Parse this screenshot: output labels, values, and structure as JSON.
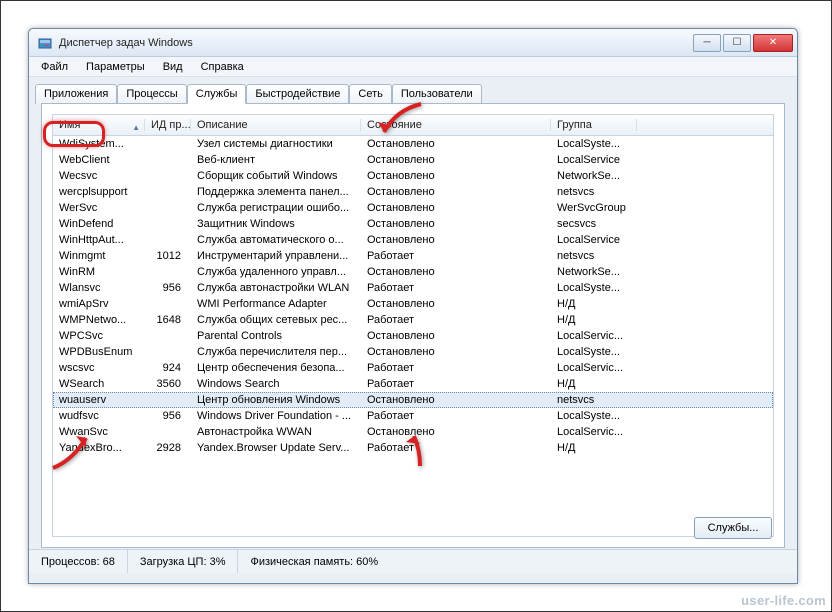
{
  "title": "Диспетчер задач Windows",
  "menu": [
    "Файл",
    "Параметры",
    "Вид",
    "Справка"
  ],
  "tabs": [
    "Приложения",
    "Процессы",
    "Службы",
    "Быстродействие",
    "Сеть",
    "Пользователи"
  ],
  "activeTab": 2,
  "columns": [
    "Имя",
    "ИД пр...",
    "Описание",
    "Состояние",
    "Группа"
  ],
  "servicesButton": "Службы...",
  "status": {
    "processes": "Процессов: 68",
    "cpu": "Загрузка ЦП: 3%",
    "memory": "Физическая память: 60%"
  },
  "watermark": "user-life.com",
  "services": [
    {
      "name": "WdiSystem...",
      "pid": "",
      "desc": "Узел системы диагностики",
      "state": "Остановлено",
      "group": "LocalSyste..."
    },
    {
      "name": "WebClient",
      "pid": "",
      "desc": "Веб-клиент",
      "state": "Остановлено",
      "group": "LocalService"
    },
    {
      "name": "Wecsvc",
      "pid": "",
      "desc": "Сборщик событий Windows",
      "state": "Остановлено",
      "group": "NetworkSe..."
    },
    {
      "name": "wercplsupport",
      "pid": "",
      "desc": "Поддержка элемента панел...",
      "state": "Остановлено",
      "group": "netsvcs"
    },
    {
      "name": "WerSvc",
      "pid": "",
      "desc": "Служба регистрации ошибо...",
      "state": "Остановлено",
      "group": "WerSvcGroup"
    },
    {
      "name": "WinDefend",
      "pid": "",
      "desc": "Защитник Windows",
      "state": "Остановлено",
      "group": "secsvcs"
    },
    {
      "name": "WinHttpAut...",
      "pid": "",
      "desc": "Служба автоматического о...",
      "state": "Остановлено",
      "group": "LocalService"
    },
    {
      "name": "Winmgmt",
      "pid": "1012",
      "desc": "Инструментарий управлени...",
      "state": "Работает",
      "group": "netsvcs"
    },
    {
      "name": "WinRM",
      "pid": "",
      "desc": "Служба удаленного управл...",
      "state": "Остановлено",
      "group": "NetworkSe..."
    },
    {
      "name": "Wlansvc",
      "pid": "956",
      "desc": "Служба автонастройки WLAN",
      "state": "Работает",
      "group": "LocalSyste..."
    },
    {
      "name": "wmiApSrv",
      "pid": "",
      "desc": "WMI Performance Adapter",
      "state": "Остановлено",
      "group": "Н/Д"
    },
    {
      "name": "WMPNetwo...",
      "pid": "1648",
      "desc": "Служба общих сетевых рес...",
      "state": "Работает",
      "group": "Н/Д"
    },
    {
      "name": "WPCSvc",
      "pid": "",
      "desc": "Parental Controls",
      "state": "Остановлено",
      "group": "LocalServic..."
    },
    {
      "name": "WPDBusEnum",
      "pid": "",
      "desc": "Служба перечислителя пер...",
      "state": "Остановлено",
      "group": "LocalSyste..."
    },
    {
      "name": "wscsvc",
      "pid": "924",
      "desc": "Центр обеспечения безопа...",
      "state": "Работает",
      "group": "LocalServic..."
    },
    {
      "name": "WSearch",
      "pid": "3560",
      "desc": "Windows Search",
      "state": "Работает",
      "group": "Н/Д"
    },
    {
      "name": "wuauserv",
      "pid": "",
      "desc": "Центр обновления Windows",
      "state": "Остановлено",
      "group": "netsvcs",
      "selected": true
    },
    {
      "name": "wudfsvc",
      "pid": "956",
      "desc": "Windows Driver Foundation - ...",
      "state": "Работает",
      "group": "LocalSyste..."
    },
    {
      "name": "WwanSvc",
      "pid": "",
      "desc": "Автонастройка WWAN",
      "state": "Остановлено",
      "group": "LocalServic..."
    },
    {
      "name": "YandexBro...",
      "pid": "2928",
      "desc": "Yandex.Browser Update Serv...",
      "state": "Работает",
      "group": "Н/Д"
    }
  ]
}
